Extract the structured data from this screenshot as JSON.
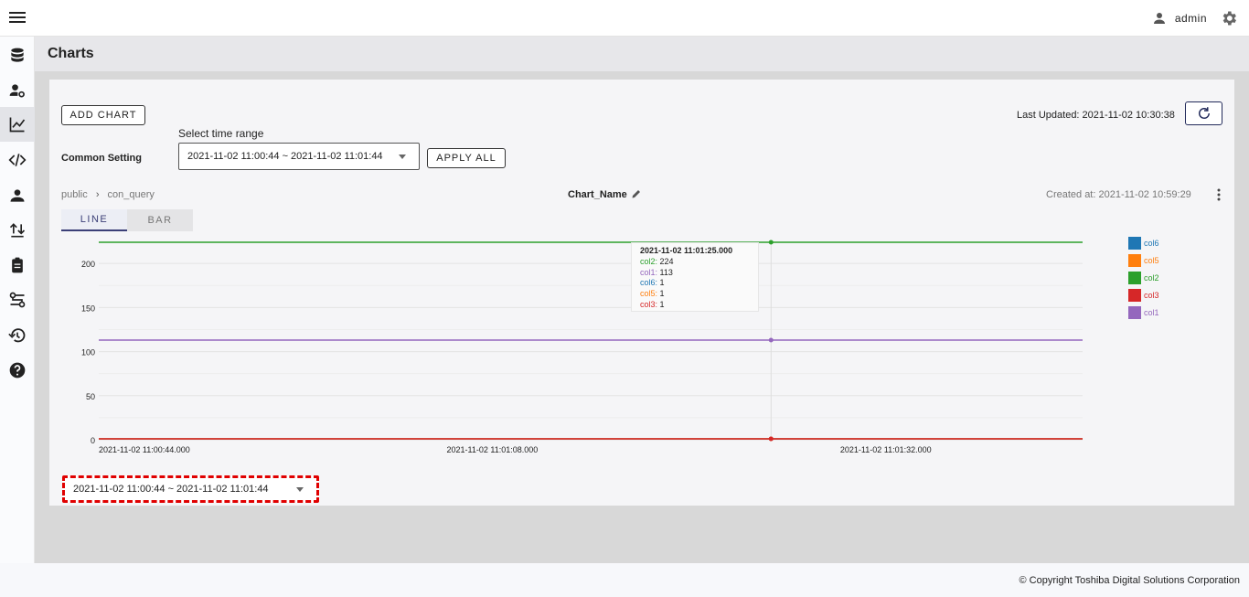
{
  "topbar": {
    "user_name": "admin"
  },
  "sidebar": {
    "items": [
      {
        "name": "database-icon"
      },
      {
        "name": "user-settings-icon"
      },
      {
        "name": "chart-icon"
      },
      {
        "name": "code-icon"
      },
      {
        "name": "users-icon"
      },
      {
        "name": "import-export-icon"
      },
      {
        "name": "clipboard-icon"
      },
      {
        "name": "settings-flow-icon"
      },
      {
        "name": "restore-icon"
      },
      {
        "name": "help-icon"
      }
    ]
  },
  "page": {
    "title": "Charts"
  },
  "toolbar": {
    "add_chart": "ADD CHART",
    "last_updated": "Last Updated: 2021-11-02 10:30:38",
    "common_setting": "Common Setting",
    "select_time_range_label": "Select time range",
    "time_range_value": "2021-11-02 11:00:44 ~ 2021-11-02 11:01:44",
    "apply_all": "APPLY ALL"
  },
  "chart_panel": {
    "breadcrumb_schema": "public",
    "breadcrumb_query": "con_query",
    "chart_name": "Chart_Name",
    "created_at": "Created at: 2021-11-02 10:59:29",
    "tabs": [
      "LINE",
      "BAR"
    ],
    "active_tab": "LINE",
    "tooltip": {
      "title": "2021-11-02 11:01:25.000",
      "rows": [
        {
          "label": "col2",
          "value": "224",
          "color": "#2ca02c"
        },
        {
          "label": "col1",
          "value": "113",
          "color": "#9467bd"
        },
        {
          "label": "col6",
          "value": "1",
          "color": "#1f77b4"
        },
        {
          "label": "col5",
          "value": "1",
          "color": "#ff7f0e"
        },
        {
          "label": "col3",
          "value": "1",
          "color": "#d62728"
        }
      ]
    },
    "range_value": "2021-11-02 11:00:44 ~ 2021-11-02 11:01:44"
  },
  "chart_data": {
    "type": "line",
    "x": [
      "2021-11-02 11:00:44.000",
      "2021-11-02 11:01:25.000",
      "2021-11-02 11:01:44.000"
    ],
    "x_tick_labels": [
      "2021-11-02 11:00:44.000",
      "2021-11-02 11:01:08.000",
      "2021-11-02 11:01:32.000"
    ],
    "y_tick_labels": [
      "0",
      "50",
      "100",
      "150",
      "200"
    ],
    "ylim": [
      0,
      224
    ],
    "series": [
      {
        "name": "col6",
        "color": "#1f77b4",
        "values": [
          1,
          1,
          1
        ]
      },
      {
        "name": "col5",
        "color": "#ff7f0e",
        "values": [
          1,
          1,
          1
        ]
      },
      {
        "name": "col2",
        "color": "#2ca02c",
        "values": [
          224,
          224,
          224
        ]
      },
      {
        "name": "col3",
        "color": "#d62728",
        "values": [
          1,
          1,
          1
        ]
      },
      {
        "name": "col1",
        "color": "#9467bd",
        "values": [
          113,
          113,
          113
        ]
      }
    ],
    "grid": true,
    "legend_position": "right"
  },
  "footer": {
    "copyright": "© Copyright Toshiba Digital Solutions Corporation"
  }
}
